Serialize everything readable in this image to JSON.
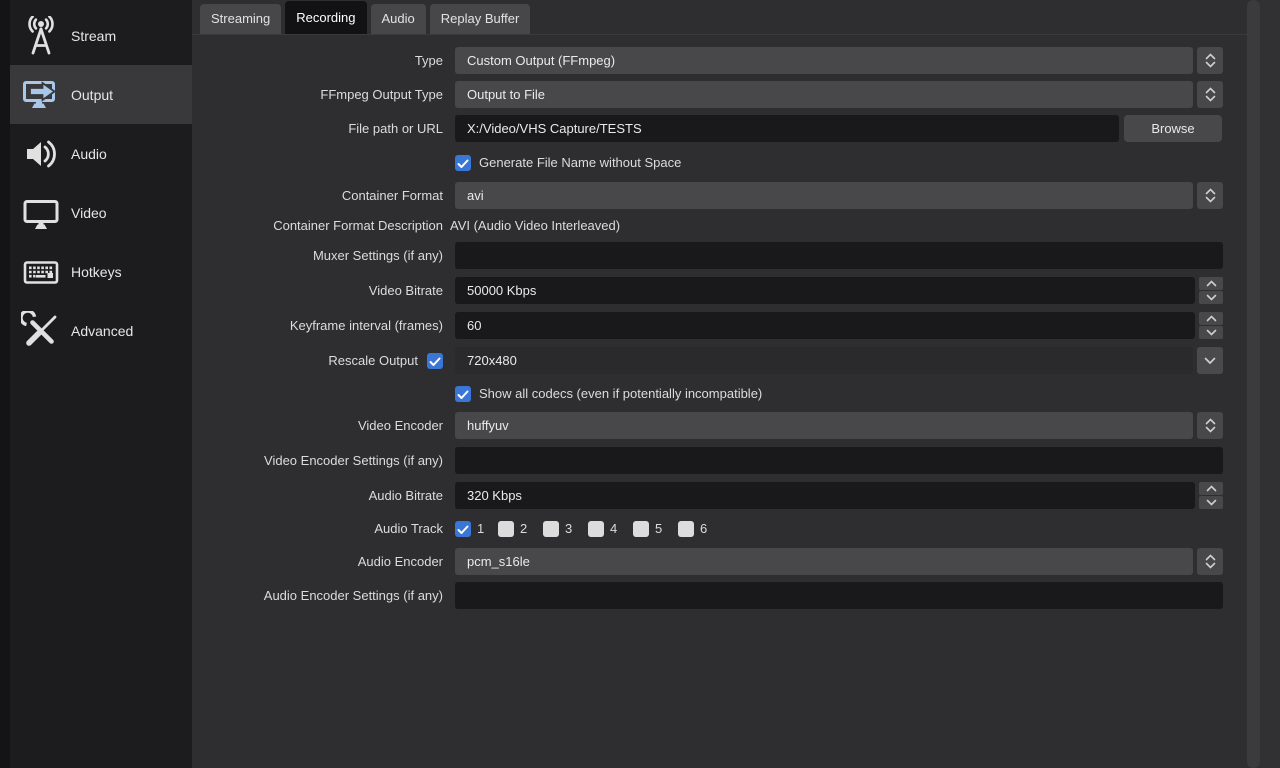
{
  "sidebar": {
    "items": [
      {
        "label": "Stream",
        "icon": "stream-icon",
        "selected": false
      },
      {
        "label": "Output",
        "icon": "output-icon",
        "selected": true
      },
      {
        "label": "Audio",
        "icon": "audio-icon",
        "selected": false
      },
      {
        "label": "Video",
        "icon": "video-icon",
        "selected": false
      },
      {
        "label": "Hotkeys",
        "icon": "hotkeys-icon",
        "selected": false
      },
      {
        "label": "Advanced",
        "icon": "advanced-icon",
        "selected": false
      }
    ]
  },
  "tabs": [
    {
      "label": "Streaming",
      "active": false
    },
    {
      "label": "Recording",
      "active": true
    },
    {
      "label": "Audio",
      "active": false
    },
    {
      "label": "Replay Buffer",
      "active": false
    }
  ],
  "form": {
    "type": {
      "label": "Type",
      "value": "Custom Output (FFmpeg)"
    },
    "ffmpeg_output_type": {
      "label": "FFmpeg Output Type",
      "value": "Output to File"
    },
    "file_path": {
      "label": "File path or URL",
      "value": "X:/Video/VHS Capture/TESTS",
      "browse_label": "Browse"
    },
    "generate_no_space": {
      "label": "Generate File Name without Space",
      "checked": true
    },
    "container_format": {
      "label": "Container Format",
      "value": "avi"
    },
    "container_format_description": {
      "label": "Container Format Description",
      "value": "AVI (Audio Video Interleaved)"
    },
    "muxer_settings": {
      "label": "Muxer Settings (if any)",
      "value": ""
    },
    "video_bitrate": {
      "label": "Video Bitrate",
      "value": "50000 Kbps"
    },
    "keyframe_interval": {
      "label": "Keyframe interval (frames)",
      "value": "60"
    },
    "rescale_output": {
      "label": "Rescale Output",
      "checked": true,
      "value": "720x480"
    },
    "show_all_codecs": {
      "label": "Show all codecs (even if potentially incompatible)",
      "checked": true
    },
    "video_encoder": {
      "label": "Video Encoder",
      "value": "huffyuv"
    },
    "video_encoder_settings": {
      "label": "Video Encoder Settings (if any)",
      "value": ""
    },
    "audio_bitrate": {
      "label": "Audio Bitrate",
      "value": "320 Kbps"
    },
    "audio_track": {
      "label": "Audio Track",
      "tracks": [
        {
          "num": "1",
          "checked": true
        },
        {
          "num": "2",
          "checked": false
        },
        {
          "num": "3",
          "checked": false
        },
        {
          "num": "4",
          "checked": false
        },
        {
          "num": "5",
          "checked": false
        },
        {
          "num": "6",
          "checked": false
        }
      ]
    },
    "audio_encoder": {
      "label": "Audio Encoder",
      "value": "pcm_s16le"
    },
    "audio_encoder_settings": {
      "label": "Audio Encoder Settings (if any)",
      "value": ""
    }
  },
  "colors": {
    "checkbox_accent": "#3a76d6",
    "selected_icon_accent": "#a8c7ea",
    "panel_bg": "#2e2e30",
    "sidebar_bg": "#1c1c1e",
    "field_gray": "#48484b",
    "field_dark": "#19191b",
    "active_tab_bg": "#121214"
  }
}
